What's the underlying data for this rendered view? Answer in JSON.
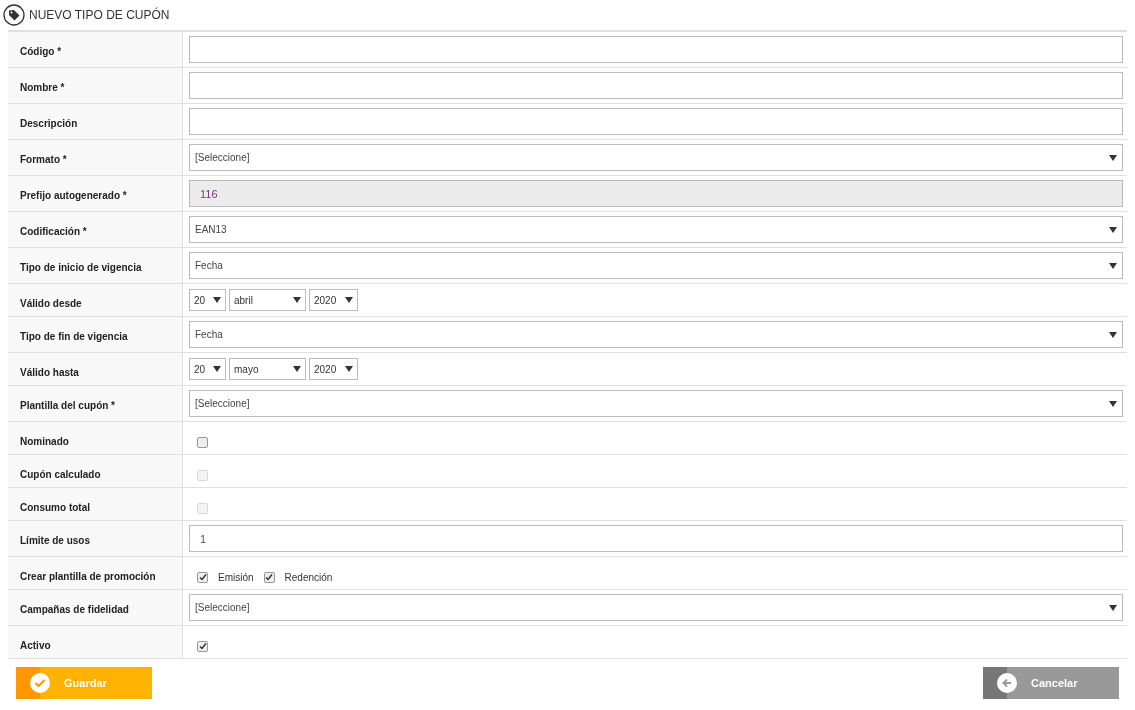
{
  "title": "NUEVO TIPO DE CUPÓN",
  "fields": [
    {
      "kind": "text",
      "label": "Código *"
    },
    {
      "kind": "text",
      "label": "Nombre *"
    },
    {
      "kind": "text",
      "label": "Descripción"
    },
    {
      "kind": "select",
      "label": "Formato *",
      "value": "[Seleccione]"
    },
    {
      "kind": "readonly",
      "label": "Prefijo autogenerado *",
      "value": "116"
    },
    {
      "kind": "select",
      "label": "Codificación *",
      "value": "EAN13"
    },
    {
      "kind": "select",
      "label": "Tipo de inicio de vigencia",
      "value": "Fecha"
    },
    {
      "kind": "date",
      "label": "Válido desde",
      "day": "20",
      "month": "abril",
      "year": "2020"
    },
    {
      "kind": "select",
      "label": "Tipo de fin de vigencia",
      "value": "Fecha"
    },
    {
      "kind": "date",
      "label": "Válido hasta",
      "day": "20",
      "month": "mayo",
      "year": "2020"
    },
    {
      "kind": "select",
      "label": "Plantilla del cupón *",
      "value": "[Seleccione]"
    },
    {
      "kind": "checkbox",
      "label": "Nominado",
      "checked": false,
      "disabled": false
    },
    {
      "kind": "checkbox",
      "label": "Cupón calculado",
      "checked": false,
      "disabled": true
    },
    {
      "kind": "checkbox",
      "label": "Consumo total",
      "checked": false,
      "disabled": true
    },
    {
      "kind": "text",
      "label": "Límite de usos",
      "value": "1"
    },
    {
      "kind": "checks",
      "label": "Crear plantilla de promoción",
      "options": [
        {
          "label": "Emisión",
          "checked": true
        },
        {
          "label": "Redención",
          "checked": true
        }
      ]
    },
    {
      "kind": "select",
      "label": "Campañas de fidelidad",
      "value": "[Seleccione]"
    },
    {
      "kind": "checkbox",
      "label": "Activo",
      "checked": true,
      "disabled": false
    }
  ],
  "buttons": [
    {
      "kind": "save",
      "label": "Guardar"
    },
    {
      "kind": "cancel",
      "label": "Cancelar"
    }
  ]
}
